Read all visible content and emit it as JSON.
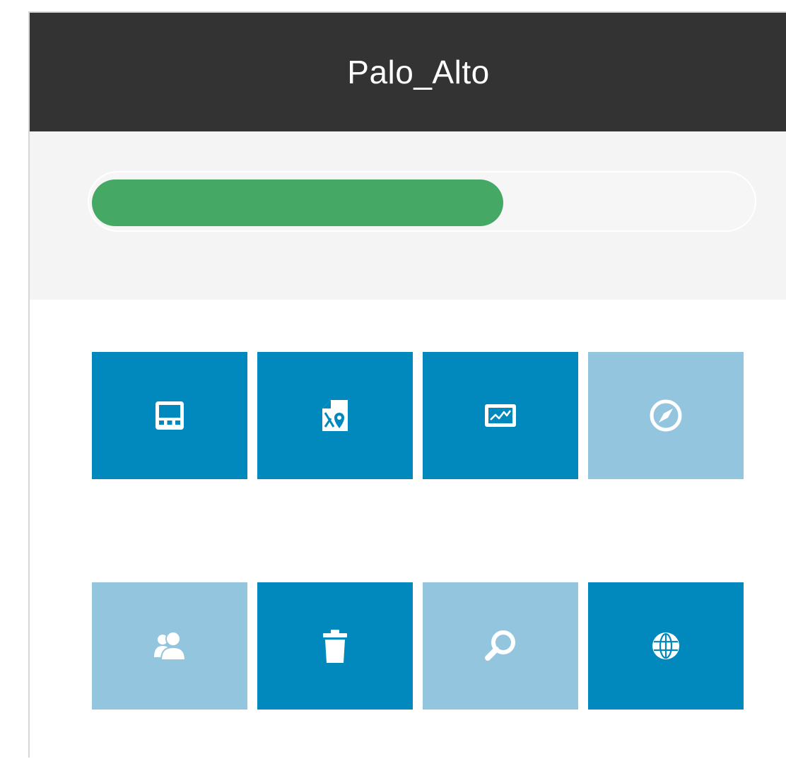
{
  "header": {
    "title": "Palo_Alto"
  },
  "progress": {
    "fraction": 0.62,
    "color": "#45a865"
  },
  "colors": {
    "header_bg": "#333333",
    "tile_active": "#0188bd",
    "tile_inactive": "#94c5de"
  },
  "tiles": [
    {
      "icon": "dashboard-panel-icon",
      "state": "active"
    },
    {
      "icon": "map-location-icon",
      "state": "active"
    },
    {
      "icon": "line-chart-icon",
      "state": "active"
    },
    {
      "icon": "compass-icon",
      "state": "inactive"
    },
    {
      "icon": "users-icon",
      "state": "inactive"
    },
    {
      "icon": "trash-icon",
      "state": "active"
    },
    {
      "icon": "search-icon",
      "state": "inactive"
    },
    {
      "icon": "globe-icon",
      "state": "active"
    }
  ]
}
